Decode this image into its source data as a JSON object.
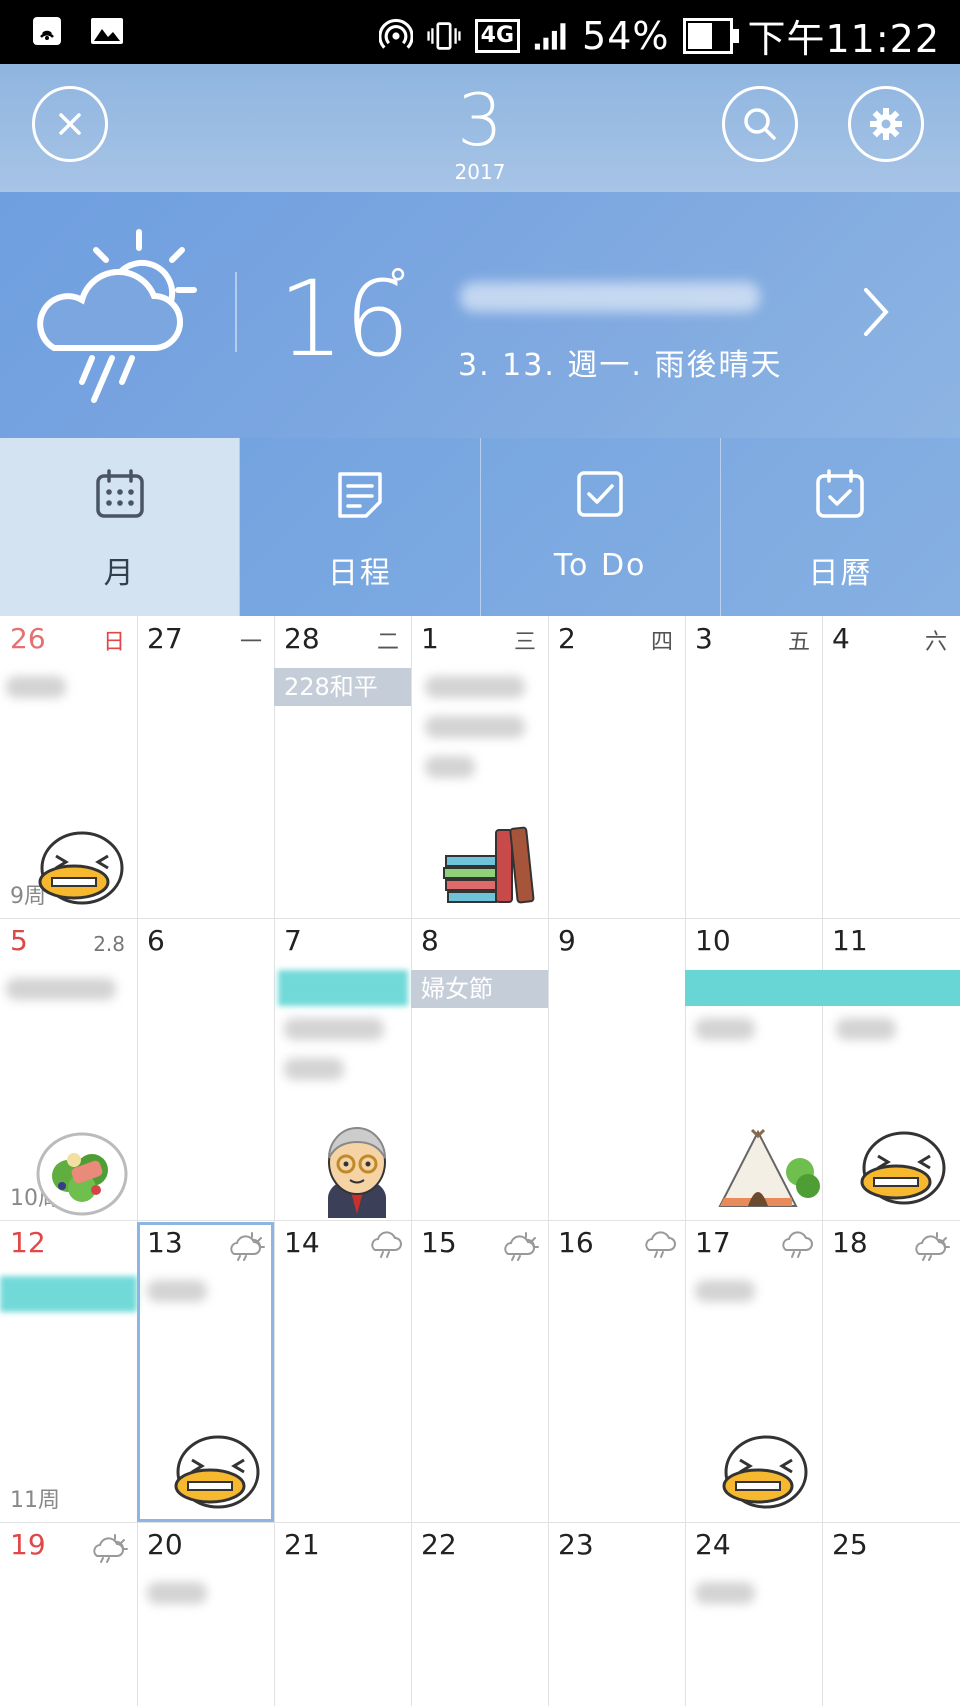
{
  "status_bar": {
    "network": "4G",
    "battery": "54%",
    "time": "下午11:22",
    "icons": [
      "nfc-icon",
      "image-icon",
      "hotspot-icon",
      "vibrate-icon",
      "network-4g-icon",
      "signal-icon",
      "battery-icon"
    ]
  },
  "header": {
    "month": "3",
    "year": "2017",
    "close_icon": "close-icon",
    "search_icon": "search-icon",
    "settings_icon": "gear-icon"
  },
  "weather": {
    "temperature": "16",
    "degree_symbol": "°",
    "description": "3. 13. 週一. 雨後晴天",
    "icon": "rain-sun-icon"
  },
  "tabs": [
    {
      "label": "月",
      "icon": "calendar-grid-icon",
      "active": true
    },
    {
      "label": "日程",
      "icon": "note-icon",
      "active": false
    },
    {
      "label": "To Do",
      "icon": "checkbox-icon",
      "active": false
    },
    {
      "label": "日曆",
      "icon": "calendar-check-icon",
      "active": false
    }
  ],
  "calendar": {
    "weekdays": [
      "日",
      "一",
      "二",
      "三",
      "四",
      "五",
      "六"
    ],
    "weeks": [
      {
        "week_label": "9周",
        "days": [
          "26",
          "27",
          "28",
          "1",
          "2",
          "3",
          "4"
        ]
      },
      {
        "week_label": "10周",
        "days": [
          "5",
          "6",
          "7",
          "8",
          "9",
          "10",
          "11"
        ]
      },
      {
        "week_label": "11周",
        "days": [
          "12",
          "13",
          "14",
          "15",
          "16",
          "17",
          "18"
        ]
      },
      {
        "week_label": "",
        "days": [
          "19",
          "20",
          "21",
          "22",
          "23",
          "24",
          "25"
        ]
      }
    ],
    "lunar_label": "2.8",
    "events": {
      "peace_day": "228和平",
      "womens_day": "婦女節"
    },
    "colors": {
      "accent": "#6f9fe0",
      "holiday_bar": "#c5ced8",
      "teal_event": "#69d6d6",
      "sunday_red": "#e04848",
      "today_border": "#8db5e2"
    }
  }
}
